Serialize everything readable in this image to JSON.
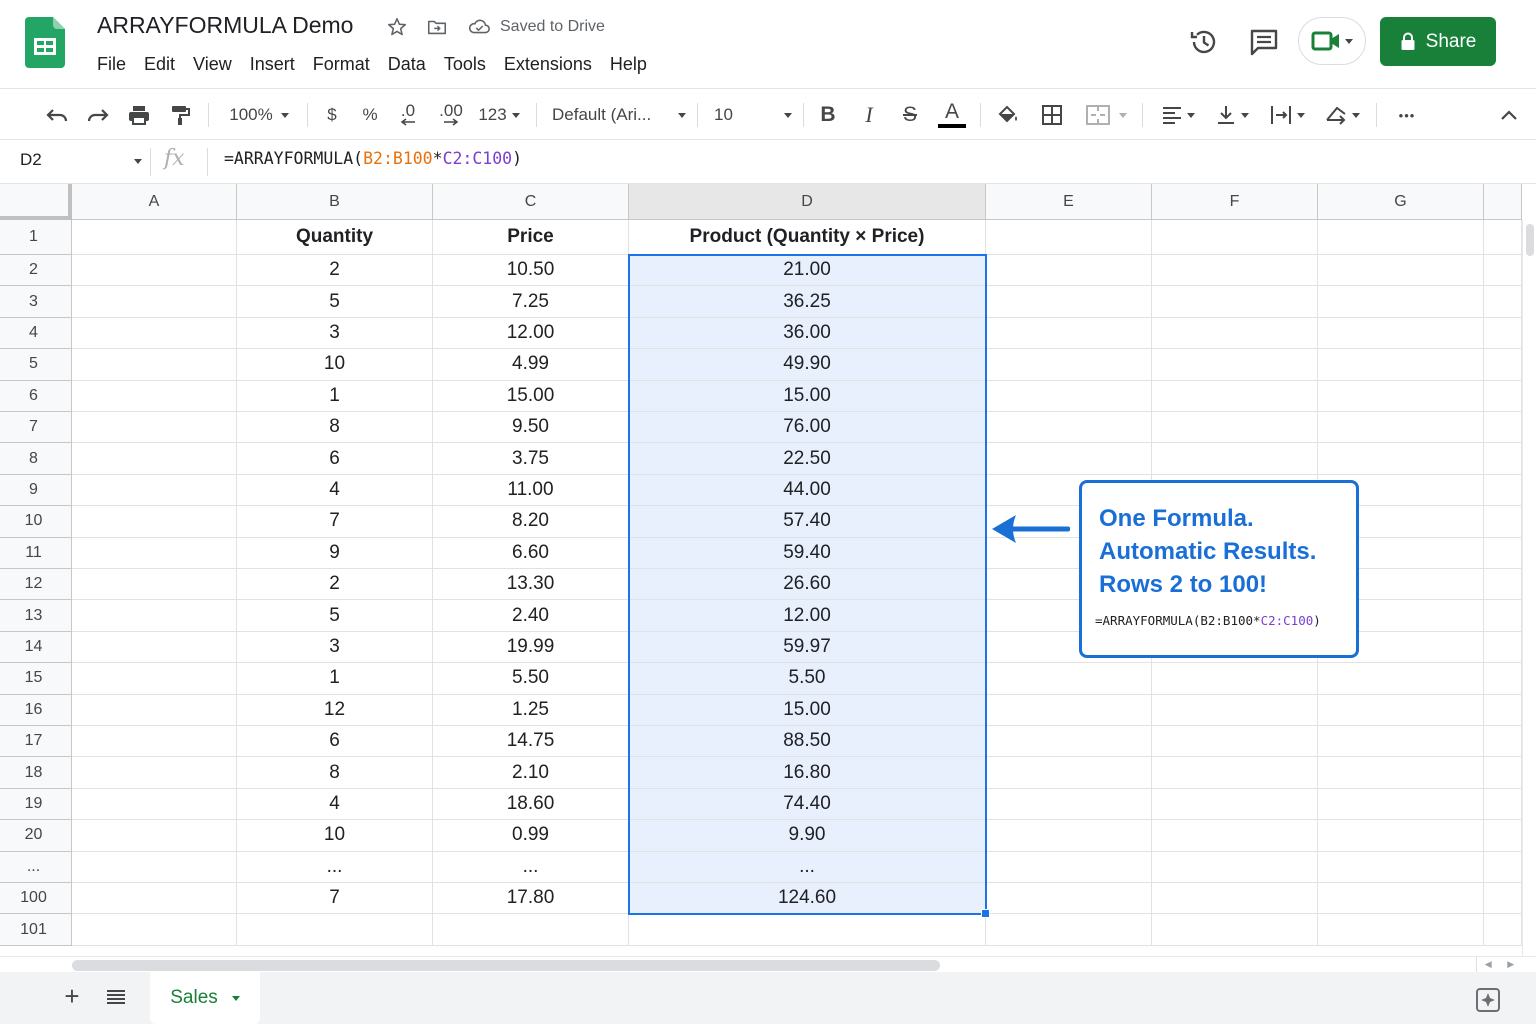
{
  "doc": {
    "title": "ARRAYFORMULA Demo",
    "saved_status": "Saved to Drive"
  },
  "menu": [
    "File",
    "Edit",
    "View",
    "Insert",
    "Format",
    "Data",
    "Tools",
    "Extensions",
    "Help"
  ],
  "share": {
    "label": "Share"
  },
  "toolbar": {
    "zoom": "100%",
    "currency": "$",
    "percent": "%",
    "dec_decrease": ".0",
    "dec_increase": ".00",
    "number_format": "123",
    "font": "Default (Ari...",
    "font_size": "10",
    "bold": "B",
    "italic": "I",
    "strike": "S",
    "text_color_letter": "A",
    "more": "•••"
  },
  "formula_bar": {
    "name_box": "D2",
    "fx": "fx",
    "formula_prefix": "=ARRAYFORMULA(",
    "range_b": "B2:B100",
    "operator": "*",
    "range_c": "C2:C100",
    "formula_suffix": ")"
  },
  "grid": {
    "columns": [
      "A",
      "B",
      "C",
      "D",
      "E",
      "F",
      "G"
    ],
    "selected_column": "D",
    "selected_cell": "D2",
    "header_row": {
      "row": "1",
      "B": "Quantity",
      "C": "Price",
      "D": "Product (Quantity × Price)"
    },
    "rows": [
      {
        "row": "2",
        "B": "2",
        "C": "10.50",
        "D": "21.00"
      },
      {
        "row": "3",
        "B": "5",
        "C": "7.25",
        "D": "36.25"
      },
      {
        "row": "4",
        "B": "3",
        "C": "12.00",
        "D": "36.00"
      },
      {
        "row": "5",
        "B": "10",
        "C": "4.99",
        "D": "49.90"
      },
      {
        "row": "6",
        "B": "1",
        "C": "15.00",
        "D": "15.00"
      },
      {
        "row": "7",
        "B": "8",
        "C": "9.50",
        "D": "76.00"
      },
      {
        "row": "8",
        "B": "6",
        "C": "3.75",
        "D": "22.50"
      },
      {
        "row": "9",
        "B": "4",
        "C": "11.00",
        "D": "44.00"
      },
      {
        "row": "10",
        "B": "7",
        "C": "8.20",
        "D": "57.40"
      },
      {
        "row": "11",
        "B": "9",
        "C": "6.60",
        "D": "59.40"
      },
      {
        "row": "12",
        "B": "2",
        "C": "13.30",
        "D": "26.60"
      },
      {
        "row": "13",
        "B": "5",
        "C": "2.40",
        "D": "12.00"
      },
      {
        "row": "14",
        "B": "3",
        "C": "19.99",
        "D": "59.97"
      },
      {
        "row": "15",
        "B": "1",
        "C": "5.50",
        "D": "5.50"
      },
      {
        "row": "16",
        "B": "12",
        "C": "1.25",
        "D": "15.00"
      },
      {
        "row": "17",
        "B": "6",
        "C": "14.75",
        "D": "88.50"
      },
      {
        "row": "18",
        "B": "8",
        "C": "2.10",
        "D": "16.80"
      },
      {
        "row": "19",
        "B": "4",
        "C": "18.60",
        "D": "74.40"
      },
      {
        "row": "20",
        "B": "10",
        "C": "0.99",
        "D": "9.90"
      },
      {
        "row": "...",
        "B": "...",
        "C": "...",
        "D": "..."
      },
      {
        "row": "100",
        "B": "7",
        "C": "17.80",
        "D": "124.60"
      },
      {
        "row": "101",
        "B": "",
        "C": "",
        "D": ""
      }
    ]
  },
  "callout": {
    "line1": "One Formula.",
    "line2": "Automatic Results.",
    "line3": "Rows 2 to 100!",
    "formula_prefix": "=ARRAYFORMULA(B2:B100*",
    "formula_range": "C2:C100",
    "formula_suffix": ")",
    "accent_color": "#1a6fd6"
  },
  "sheets": {
    "active": "Sales"
  },
  "colors": {
    "brand_green": "#188038",
    "selection_blue": "#1a73e8",
    "selection_fill": "#e8f0fe"
  }
}
